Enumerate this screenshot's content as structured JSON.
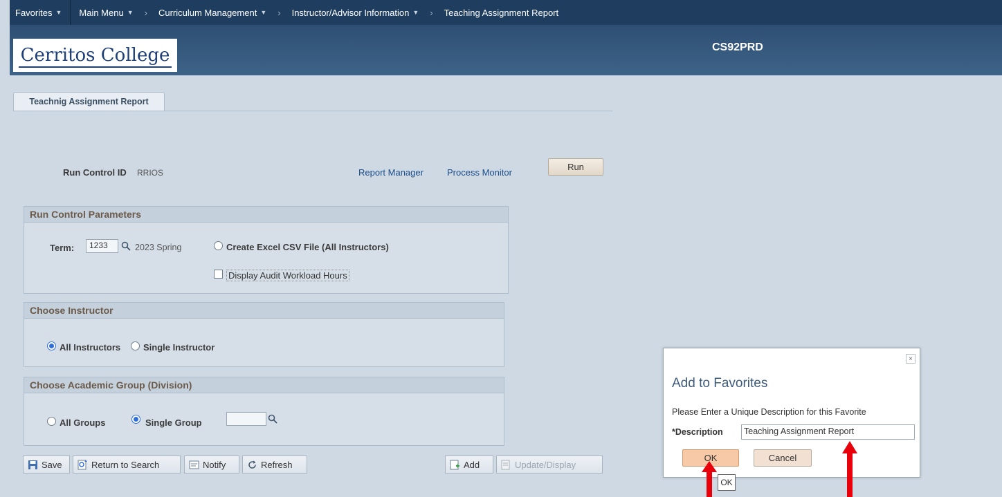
{
  "nav": {
    "favorites": "Favorites",
    "main_menu": "Main Menu",
    "breadcrumbs": [
      "Curriculum Management",
      "Instructor/Advisor Information",
      "Teaching Assignment Report"
    ]
  },
  "header": {
    "logo": "Cerritos College",
    "environment": "CS92PRD"
  },
  "tab": {
    "label": "Teachnig Assignment Report"
  },
  "run_control": {
    "label": "Run Control ID",
    "value": "RRIOS",
    "report_manager": "Report Manager",
    "process_monitor": "Process Monitor",
    "run_button": "Run"
  },
  "params": {
    "title": "Run Control Parameters",
    "term_label": "Term:",
    "term_value": "1233",
    "term_desc": "2023 Spring",
    "csv_option": "Create Excel CSV File (All Instructors)",
    "audit_checkbox": "Display Audit Workload Hours"
  },
  "instructor": {
    "title": "Choose Instructor",
    "all_label": "All Instructors",
    "single_label": "Single Instructor",
    "selected": "All Instructors"
  },
  "academic_group": {
    "title": "Choose Academic Group (Division)",
    "all_label": "All Groups",
    "single_label": "Single Group",
    "selected": "Single Group",
    "group_value": ""
  },
  "toolbar": {
    "save": "Save",
    "return_to_search": "Return to Search",
    "notify": "Notify",
    "refresh": "Refresh",
    "add": "Add",
    "update_display": "Update/Display"
  },
  "modal": {
    "close": "×",
    "title": "Add to Favorites",
    "prompt": "Please Enter a Unique Description for this Favorite",
    "description_label": "*Description",
    "description_value": "Teaching Assignment Report",
    "ok": "OK",
    "cancel": "Cancel",
    "tooltip": "OK"
  },
  "colors": {
    "nav": "#1f3d5e",
    "accent": "#2d6fd6",
    "annotation_arrow": "#e8000b"
  }
}
